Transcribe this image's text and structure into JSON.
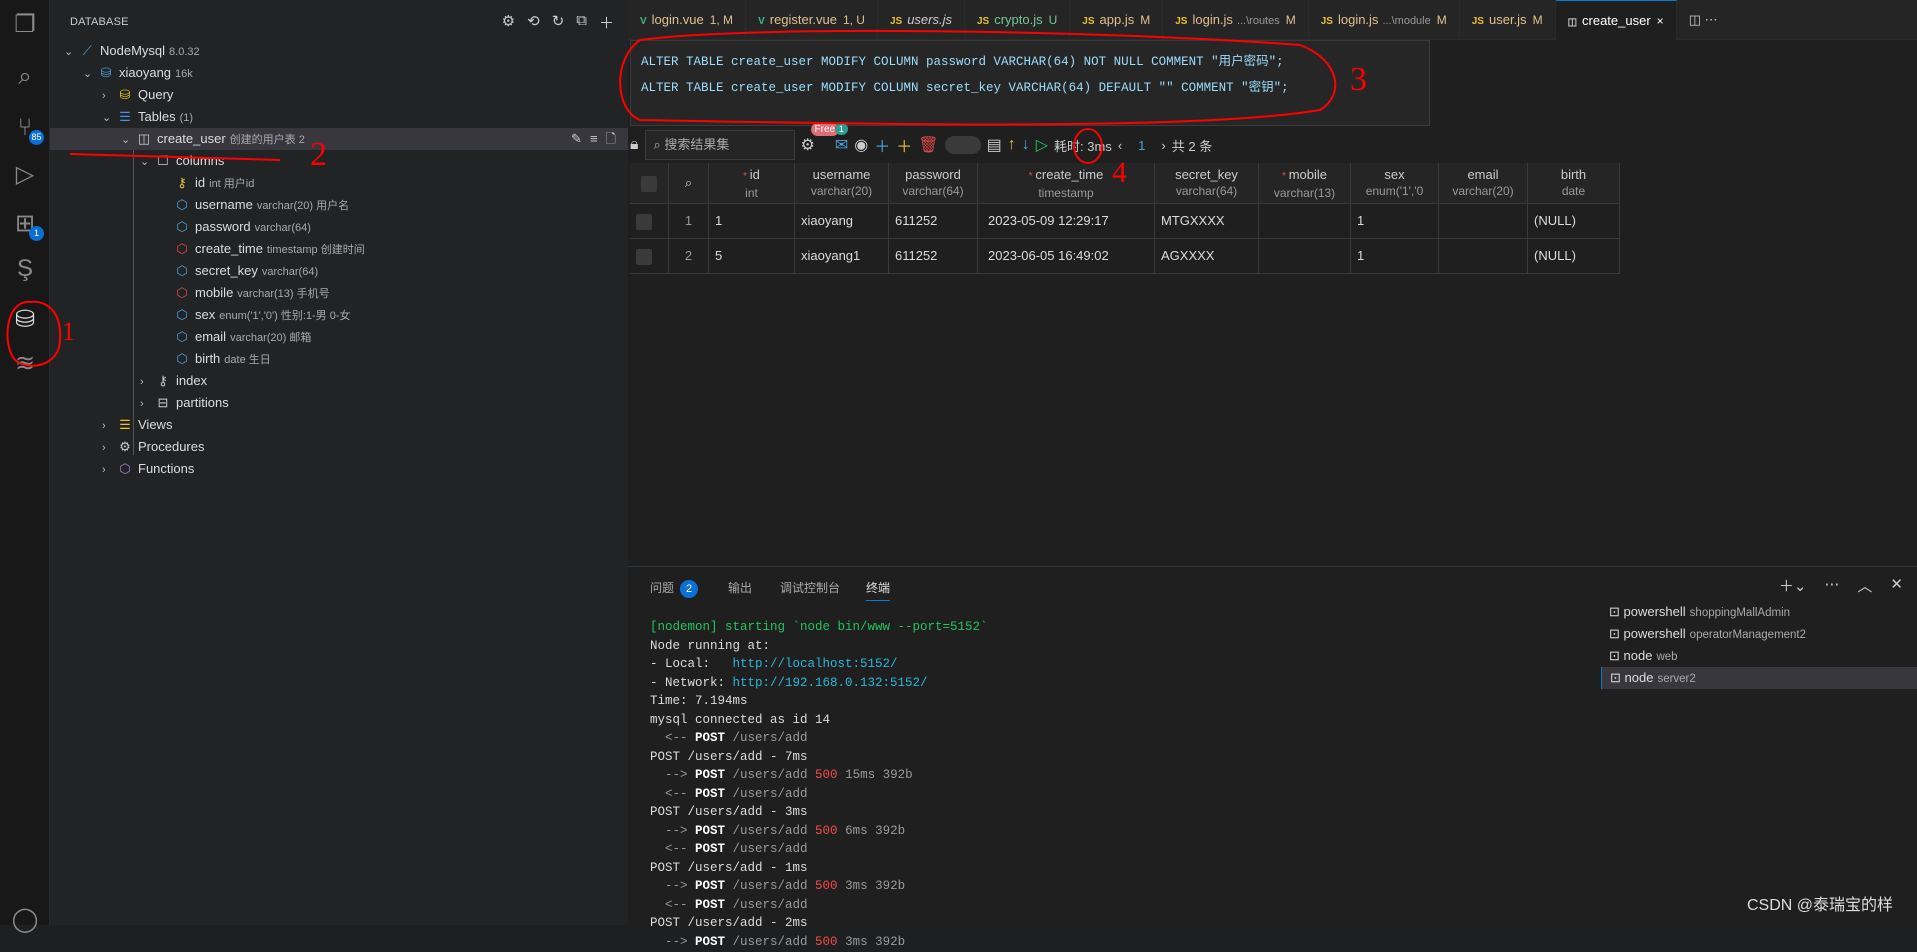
{
  "activity": [
    {
      "icon": "files-icon"
    },
    {
      "icon": "search-icon"
    },
    {
      "icon": "source-control-icon",
      "badge": "85"
    },
    {
      "icon": "run-debug-icon"
    },
    {
      "icon": "extensions-icon",
      "badge": "1"
    },
    {
      "icon": "s-extension-icon"
    },
    {
      "icon": "database-icon"
    },
    {
      "icon": "layers-icon"
    }
  ],
  "sidebar": {
    "title": "DATABASE",
    "tree": [
      {
        "label": "NodeMysql",
        "meta": "8.0.32",
        "chev": "⌄",
        "icon": "⟋",
        "color": "#4aa3df",
        "level": 0
      },
      {
        "label": "xiaoyang",
        "meta": "16k",
        "chev": "⌄",
        "icon": "⛁",
        "color": "#4aa3df",
        "level": 1
      },
      {
        "label": "Query",
        "meta": "",
        "chev": "›",
        "icon": "⛁",
        "color": "#e8c02a",
        "level": 2
      },
      {
        "label": "Tables",
        "meta": "(1)",
        "chev": "⌄",
        "icon": "☰",
        "color": "#4a90e2",
        "level": 2
      },
      {
        "label": "create_user",
        "meta": "创建的用户表 2",
        "chev": "⌄",
        "icon": "◫",
        "color": "#ccc",
        "level": 3,
        "selected": true
      },
      {
        "label": "columns",
        "meta": "",
        "chev": "⌄",
        "icon": "☐",
        "color": "#ccc",
        "level": 4
      },
      {
        "label": "id",
        "meta": "int 用户id",
        "icon": "⚷",
        "color": "#e8c02a",
        "level": 5
      },
      {
        "label": "username",
        "meta": "varchar(20) 用户名",
        "icon": "⬡",
        "color": "#4aa3df",
        "level": 5
      },
      {
        "label": "password",
        "meta": "varchar(64)",
        "icon": "⬡",
        "color": "#4aa3df",
        "level": 5
      },
      {
        "label": "create_time",
        "meta": "timestamp 创建时间",
        "icon": "⬡",
        "color": "#e04848",
        "level": 5
      },
      {
        "label": "secret_key",
        "meta": "varchar(64)",
        "icon": "⬡",
        "color": "#4aa3df",
        "level": 5
      },
      {
        "label": "mobile",
        "meta": "varchar(13) 手机号",
        "icon": "⬡",
        "color": "#e04848",
        "level": 5
      },
      {
        "label": "sex",
        "meta": "enum('1','0') 性别:1-男 0-女",
        "icon": "⬡",
        "color": "#4aa3df",
        "level": 5
      },
      {
        "label": "email",
        "meta": "varchar(20) 邮箱",
        "icon": "⬡",
        "color": "#4aa3df",
        "level": 5
      },
      {
        "label": "birth",
        "meta": "date 生日",
        "icon": "⬡",
        "color": "#4aa3df",
        "level": 5
      },
      {
        "label": "index",
        "meta": "",
        "chev": "›",
        "icon": "⚷",
        "color": "#ccc",
        "level": 4
      },
      {
        "label": "partitions",
        "meta": "",
        "chev": "›",
        "icon": "⊟",
        "color": "#ccc",
        "level": 4
      },
      {
        "label": "Views",
        "meta": "",
        "chev": "›",
        "icon": "☰",
        "color": "#e8c02a",
        "level": 2
      },
      {
        "label": "Procedures",
        "meta": "",
        "chev": "›",
        "icon": "⚙",
        "color": "#ccc",
        "level": 2
      },
      {
        "label": "Functions",
        "meta": "",
        "chev": "›",
        "icon": "⬡",
        "color": "#b180d7",
        "level": 2
      }
    ]
  },
  "tabs": [
    {
      "label": "login.vue",
      "status": "1, M",
      "type": "vue",
      "color": "#e2c08d"
    },
    {
      "label": "register.vue",
      "status": "1, U",
      "type": "vue",
      "color": "#e2c08d"
    },
    {
      "label": "users.js",
      "status": "",
      "type": "js",
      "color": "#ccc",
      "italic": true
    },
    {
      "label": "crypto.js",
      "status": "U",
      "type": "js",
      "color": "#73c991"
    },
    {
      "label": "app.js",
      "status": "M",
      "type": "js",
      "color": "#e2c08d"
    },
    {
      "label": "login.js",
      "desc": "...\\routes",
      "status": "M",
      "type": "js",
      "color": "#e2c08d"
    },
    {
      "label": "login.js",
      "desc": "...\\module",
      "status": "M",
      "type": "js",
      "color": "#e2c08d"
    },
    {
      "label": "user.js",
      "status": "M",
      "type": "js",
      "color": "#e2c08d"
    },
    {
      "label": "create_user",
      "status": "×",
      "type": "table",
      "color": "#fff",
      "active": true
    }
  ],
  "sql": [
    "ALTER TABLE create_user MODIFY COLUMN password VARCHAR(64) NOT NULL COMMENT \"用户密码\";",
    "ALTER TABLE create_user MODIFY COLUMN secret_key VARCHAR(64) DEFAULT \"\" COMMENT \"密钥\";"
  ],
  "toolbar": {
    "search_placeholder": "搜索结果集",
    "free_badge": "Free",
    "mail_badge": "1",
    "cost": "耗时: 3ms",
    "page": "1",
    "total": "共 2 条"
  },
  "grid": {
    "columns": [
      {
        "name": "id",
        "type": "int",
        "required": true
      },
      {
        "name": "username",
        "type": "varchar(20)"
      },
      {
        "name": "password",
        "type": "varchar(64)"
      },
      {
        "name": "create_time",
        "type": "timestamp",
        "required": true
      },
      {
        "name": "secret_key",
        "type": "varchar(64)"
      },
      {
        "name": "mobile",
        "type": "varchar(13)",
        "required": true
      },
      {
        "name": "sex",
        "type": "enum('1','0"
      },
      {
        "name": "email",
        "type": "varchar(20)"
      },
      {
        "name": "birth",
        "type": "date"
      }
    ],
    "rows": [
      {
        "n": "1",
        "cells": [
          "1",
          "xiaoyang",
          "611252",
          "2023-05-09 12:29:17",
          "MTGXXXX",
          "",
          "1",
          "",
          "(NULL)"
        ]
      },
      {
        "n": "2",
        "cells": [
          "5",
          "xiaoyang1",
          "611252",
          "2023-06-05 16:49:02",
          "AGXXXX",
          "",
          "1",
          "",
          "(NULL)"
        ]
      }
    ]
  },
  "panel": {
    "tabs": [
      "问题",
      "输出",
      "调试控制台",
      "终端"
    ],
    "problems_count": "2",
    "active": "终端",
    "terminal": [
      [
        [
          "g",
          "[nodemon] starting `node bin/www --port=5152`"
        ]
      ],
      [
        [
          "",
          "Node running at:"
        ]
      ],
      [
        [
          "",
          "- Local:   "
        ],
        [
          "b",
          "http://localhost:5152/"
        ]
      ],
      [
        [
          "",
          "- Network: "
        ],
        [
          "b",
          "http://192.168.0.132:5152/"
        ]
      ],
      [
        [
          "",
          "Time: 7.194ms"
        ]
      ],
      [
        [
          "",
          "mysql connected as id 14"
        ]
      ],
      [
        [
          "d",
          "  <-- "
        ],
        [
          "w",
          "POST"
        ],
        [
          "d",
          " /users/add"
        ]
      ],
      [
        [
          "",
          "POST /users/add - 7ms"
        ]
      ],
      [
        [
          "d",
          "  --> "
        ],
        [
          "w",
          "POST"
        ],
        [
          "d",
          " /users/add "
        ],
        [
          "r",
          "500"
        ],
        [
          "d",
          " 15ms 392b"
        ]
      ],
      [
        [
          "d",
          "  <-- "
        ],
        [
          "w",
          "POST"
        ],
        [
          "d",
          " /users/add"
        ]
      ],
      [
        [
          "",
          "POST /users/add - 3ms"
        ]
      ],
      [
        [
          "d",
          "  --> "
        ],
        [
          "w",
          "POST"
        ],
        [
          "d",
          " /users/add "
        ],
        [
          "r",
          "500"
        ],
        [
          "d",
          " 6ms 392b"
        ]
      ],
      [
        [
          "d",
          "  <-- "
        ],
        [
          "w",
          "POST"
        ],
        [
          "d",
          " /users/add"
        ]
      ],
      [
        [
          "",
          "POST /users/add - 1ms"
        ]
      ],
      [
        [
          "d",
          "  --> "
        ],
        [
          "w",
          "POST"
        ],
        [
          "d",
          " /users/add "
        ],
        [
          "r",
          "500"
        ],
        [
          "d",
          " 3ms 392b"
        ]
      ],
      [
        [
          "d",
          "  <-- "
        ],
        [
          "w",
          "POST"
        ],
        [
          "d",
          " /users/add"
        ]
      ],
      [
        [
          "",
          "POST /users/add - 2ms"
        ]
      ],
      [
        [
          "d",
          "  --> "
        ],
        [
          "w",
          "POST"
        ],
        [
          "d",
          " /users/add "
        ],
        [
          "r",
          "500"
        ],
        [
          "d",
          " 3ms 392b"
        ]
      ]
    ],
    "terminals": [
      {
        "name": "powershell",
        "desc": "shoppingMallAdmin"
      },
      {
        "name": "powershell",
        "desc": "operatorManagement2"
      },
      {
        "name": "node",
        "desc": "web"
      },
      {
        "name": "node",
        "desc": "server2",
        "active": true
      }
    ]
  },
  "annotations": [
    "1",
    "2",
    "3",
    "4"
  ],
  "annotation_color": "#ff0000",
  "watermark": "CSDN @泰瑞宝的样"
}
